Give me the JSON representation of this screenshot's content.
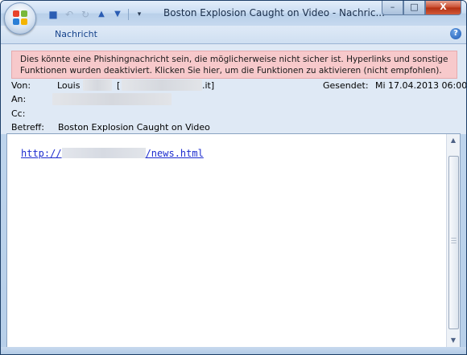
{
  "window": {
    "title": "Boston Explosion Caught on Video  -  Nachric..."
  },
  "qat": {
    "save_icon": "save-icon",
    "undo_icon": "undo-icon",
    "redo_icon": "redo-icon",
    "prev_icon": "up-arrow-icon",
    "next_icon": "down-arrow-icon",
    "customize_icon": "customize-icon"
  },
  "window_buttons": {
    "minimize": "–",
    "maximize": "□",
    "close": "X"
  },
  "ribbon": {
    "tab_label": "Nachricht",
    "help": "?"
  },
  "warning": {
    "text": "Dies könnte eine Phishingnachricht sein, die möglicherweise nicht sicher ist. Hyperlinks und sonstige Funktionen wurden deaktiviert. Klicken Sie hier, um die Funktionen zu aktivieren (nicht empfohlen)."
  },
  "fields": {
    "from_label": "Von:",
    "from_name": "Louis",
    "from_address_start": "[",
    "from_address_end": ".it]",
    "to_label": "An:",
    "cc_label": "Cc:",
    "sent_label": "Gesendet:",
    "sent_value": "Mi 17.04.2013 06:00",
    "subject_label": "Betreff:",
    "subject_value": "Boston Explosion Caught on Video"
  },
  "body": {
    "url_prefix": "http://",
    "url_suffix": "/news.html"
  },
  "colors": {
    "warning_bg": "#f7c9cb",
    "link": "#1d2ccf",
    "ribbon_text": "#15428b"
  }
}
